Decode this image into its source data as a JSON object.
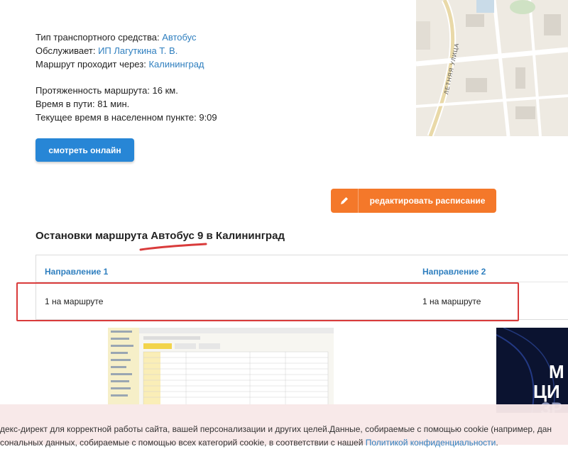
{
  "info": {
    "transport_label": "Тип транспортного средства: ",
    "transport_value": "Автобус",
    "operator_label": "Обслуживает: ",
    "operator_value": "ИП Лагуткина Т. В.",
    "via_label": "Маршрут проходит через: ",
    "via_value": "Калининград",
    "length": "Протяженность маршрута: 16 км.",
    "duration": "Время в пути: 81 мин.",
    "current_time": "Текущее время в населенном пункте: 9:09"
  },
  "map": {
    "street_label": "ЛЕТНЯЯ УЛИЦА"
  },
  "buttons": {
    "watch_online": "смотреть онлайн",
    "edit_schedule": "редактировать расписание"
  },
  "stops": {
    "heading_prefix": "Остановки маршрута ",
    "heading_route": "Автобус 9",
    "heading_suffix": " в Калининград",
    "direction1": "Направление 1",
    "direction2": "Направление 2",
    "count1": "1 на маршруте",
    "count2": "1 на маршруте"
  },
  "ad_right": {
    "line1": "М",
    "line2": "ЦИ",
    "line3": "ЗР"
  },
  "cookie": {
    "line1": "декс-директ для корректной работы сайта, вашей персонализации и других целей.Данные, собираемые с помощью cookie (например, дан",
    "line2_prefix": "сональных данных, собираемые с помощью всех категорий cookie, в соответствии с нашей ",
    "line2_link": "Политикой конфиденциальности",
    "line2_suffix": "."
  },
  "colors": {
    "link": "#2f7fbf",
    "primary": "#2786d6",
    "accent": "#f4782a",
    "highlight": "#d93b3b"
  }
}
